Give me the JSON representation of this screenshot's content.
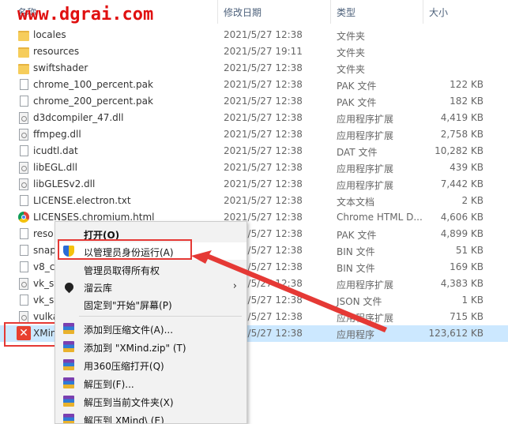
{
  "watermark": "www.dgrai.com",
  "columns": {
    "name": "名称",
    "date": "修改日期",
    "type": "类型",
    "size": "大小"
  },
  "files": [
    {
      "name": "locales",
      "date": "2021/5/27 12:38",
      "type": "文件夹",
      "size": "",
      "icon": "folder-icon"
    },
    {
      "name": "resources",
      "date": "2021/5/27 19:11",
      "type": "文件夹",
      "size": "",
      "icon": "folder-icon"
    },
    {
      "name": "swiftshader",
      "date": "2021/5/27 12:38",
      "type": "文件夹",
      "size": "",
      "icon": "folder-icon"
    },
    {
      "name": "chrome_100_percent.pak",
      "date": "2021/5/27 12:38",
      "type": "PAK 文件",
      "size": "122 KB",
      "icon": "file-icon"
    },
    {
      "name": "chrome_200_percent.pak",
      "date": "2021/5/27 12:38",
      "type": "PAK 文件",
      "size": "182 KB",
      "icon": "file-icon"
    },
    {
      "name": "d3dcompiler_47.dll",
      "date": "2021/5/27 12:38",
      "type": "应用程序扩展",
      "size": "4,419 KB",
      "icon": "dll-icon"
    },
    {
      "name": "ffmpeg.dll",
      "date": "2021/5/27 12:38",
      "type": "应用程序扩展",
      "size": "2,758 KB",
      "icon": "dll-icon"
    },
    {
      "name": "icudtl.dat",
      "date": "2021/5/27 12:38",
      "type": "DAT 文件",
      "size": "10,282 KB",
      "icon": "file-icon"
    },
    {
      "name": "libEGL.dll",
      "date": "2021/5/27 12:38",
      "type": "应用程序扩展",
      "size": "439 KB",
      "icon": "dll-icon"
    },
    {
      "name": "libGLESv2.dll",
      "date": "2021/5/27 12:38",
      "type": "应用程序扩展",
      "size": "7,442 KB",
      "icon": "dll-icon"
    },
    {
      "name": "LICENSE.electron.txt",
      "date": "2021/5/27 12:38",
      "type": "文本文档",
      "size": "2 KB",
      "icon": "file-icon"
    },
    {
      "name": "LICENSES.chromium.html",
      "date": "2021/5/27 12:38",
      "type": "Chrome HTML D...",
      "size": "4,606 KB",
      "icon": "chrome-icon"
    },
    {
      "name": "reso",
      "date": "2021/5/27 12:38",
      "type": "PAK 文件",
      "size": "4,899 KB",
      "icon": "file-icon"
    },
    {
      "name": "snap",
      "date": "2021/5/27 12:38",
      "type": "BIN 文件",
      "size": "51 KB",
      "icon": "file-icon"
    },
    {
      "name": "v8_co",
      "date": "2021/5/27 12:38",
      "type": "BIN 文件",
      "size": "169 KB",
      "icon": "file-icon"
    },
    {
      "name": "vk_sw",
      "date": "2021/5/27 12:38",
      "type": "应用程序扩展",
      "size": "4,383 KB",
      "icon": "dll-icon"
    },
    {
      "name": "vk_sw",
      "date": "2021/5/27 12:38",
      "type": "JSON 文件",
      "size": "1 KB",
      "icon": "file-icon"
    },
    {
      "name": "vulka",
      "date": "2021/5/27 12:38",
      "type": "应用程序扩展",
      "size": "715 KB",
      "icon": "dll-icon"
    },
    {
      "name": "XMind",
      "date": "2021/5/27 12:38",
      "type": "应用程序",
      "size": "123,612 KB",
      "icon": "xmind-icon",
      "selected": true
    }
  ],
  "context_menu": {
    "items": [
      {
        "label": "打开(O)",
        "bold": true
      },
      {
        "label": "以管理员身份运行(A)",
        "icon": "uac-shield-icon",
        "highlighted": true
      },
      {
        "label": "管理员取得所有权"
      },
      {
        "label": "溜云库",
        "icon": "liuyunku-icon",
        "submenu": true
      },
      {
        "label": "固定到\"开始\"屏幕(P)"
      },
      {
        "label": "添加到压缩文件(A)...",
        "icon": "winrar-icon"
      },
      {
        "label": "添加到 \"XMind.zip\" (T)",
        "icon": "winrar-icon"
      },
      {
        "label": "用360压缩打开(Q)",
        "icon": "winrar-icon"
      },
      {
        "label": "解压到(F)...",
        "icon": "winrar-icon"
      },
      {
        "label": "解压到当前文件夹(X)",
        "icon": "winrar-icon"
      },
      {
        "label": "解压到 XMind\\ (E)",
        "icon": "winrar-icon"
      }
    ]
  },
  "annotation_color": "#e53935"
}
